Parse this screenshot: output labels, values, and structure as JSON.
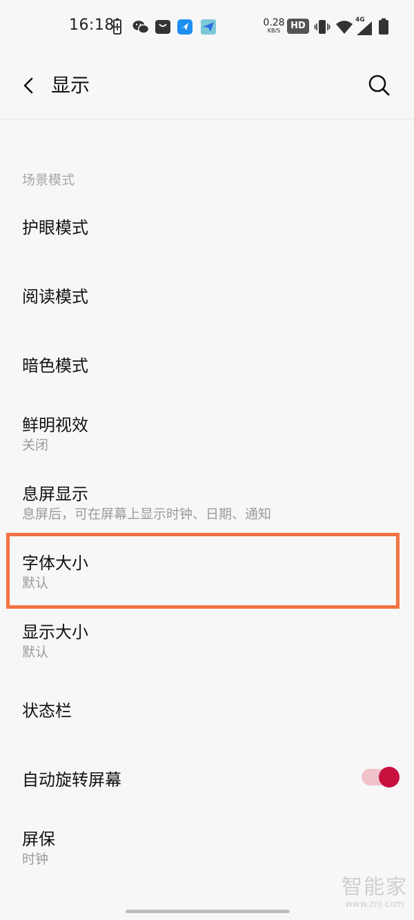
{
  "status_bar": {
    "time": "16:18",
    "net_speed_value": "0.28",
    "net_speed_unit": "KB/S",
    "hd_badge": "HD",
    "network_type": "4G"
  },
  "header": {
    "title": "显示"
  },
  "section": {
    "title": "场景模式"
  },
  "items": [
    {
      "title": "护眼模式"
    },
    {
      "title": "阅读模式"
    },
    {
      "title": "暗色模式"
    },
    {
      "title": "鲜明视效",
      "subtitle": "关闭"
    },
    {
      "title": "息屏显示",
      "subtitle": "息屏后，可在屏幕上显示时钟、日期、通知"
    },
    {
      "title": "字体大小",
      "subtitle": "默认"
    },
    {
      "title": "显示大小",
      "subtitle": "默认"
    },
    {
      "title": "状态栏"
    },
    {
      "title": "自动旋转屏幕",
      "toggle_on": true
    },
    {
      "title": "屏保",
      "subtitle": "时钟"
    }
  ],
  "colors": {
    "highlight_border": "#f47342",
    "toggle_knob": "#c8103f",
    "toggle_track": "#f2c2cb"
  },
  "watermark": {
    "brand": "智能家",
    "url": "www.znj.com"
  }
}
